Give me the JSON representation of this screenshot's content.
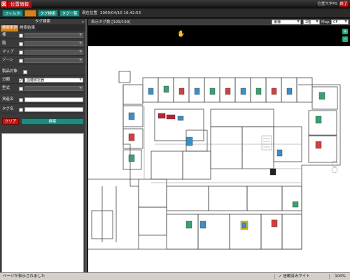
{
  "titlebar": {
    "logo_glyph": "図",
    "title": "位置情報",
    "system_name": "位置大学PS",
    "exit_label": "終了"
  },
  "toolbar": {
    "filter_label": "フィルタ",
    "tab2_label": "",
    "tag_search_label": "タグ検索",
    "tag_list_label": "タグ一覧",
    "current_position_label": "現在位置",
    "current_time": "2009/04/10 16:42:53"
  },
  "left_panel": {
    "header": "タグ検索",
    "collapse_glyph": "«",
    "tab_conditions": "検索条件",
    "tab_results": "検索結果",
    "fields": [
      {
        "label": "棟",
        "value": "",
        "checked": false
      },
      {
        "label": "階",
        "value": "",
        "checked": false
      },
      {
        "label": "マップ",
        "value": "",
        "checked": false
      },
      {
        "label": "ゾーン",
        "value": "",
        "checked": false
      },
      {
        "label": "製品対象",
        "value": "",
        "checked": false
      },
      {
        "label": "分類",
        "value": "血糖測定器",
        "checked": true
      },
      {
        "label": "型式",
        "value": "",
        "checked": false
      },
      {
        "label": "資産名",
        "value": "",
        "checked": false
      },
      {
        "label": "タグ名",
        "value": "",
        "checked": false
      }
    ],
    "clear_label": "クリア",
    "search_label": "検索"
  },
  "map_header": {
    "tag_count_label": "表示タグ数",
    "tag_count": "199/199",
    "building": "東棟",
    "floor": "2階",
    "map_label": "Map",
    "map_value": "CF"
  },
  "statusbar": {
    "message": "ページが表示されました",
    "zone": "信頼済みサイト",
    "zoom": "100%"
  },
  "colors": {
    "accent_teal": "#1f8b7f",
    "accent_orange": "#d7811d",
    "danger_red": "#c41414"
  }
}
